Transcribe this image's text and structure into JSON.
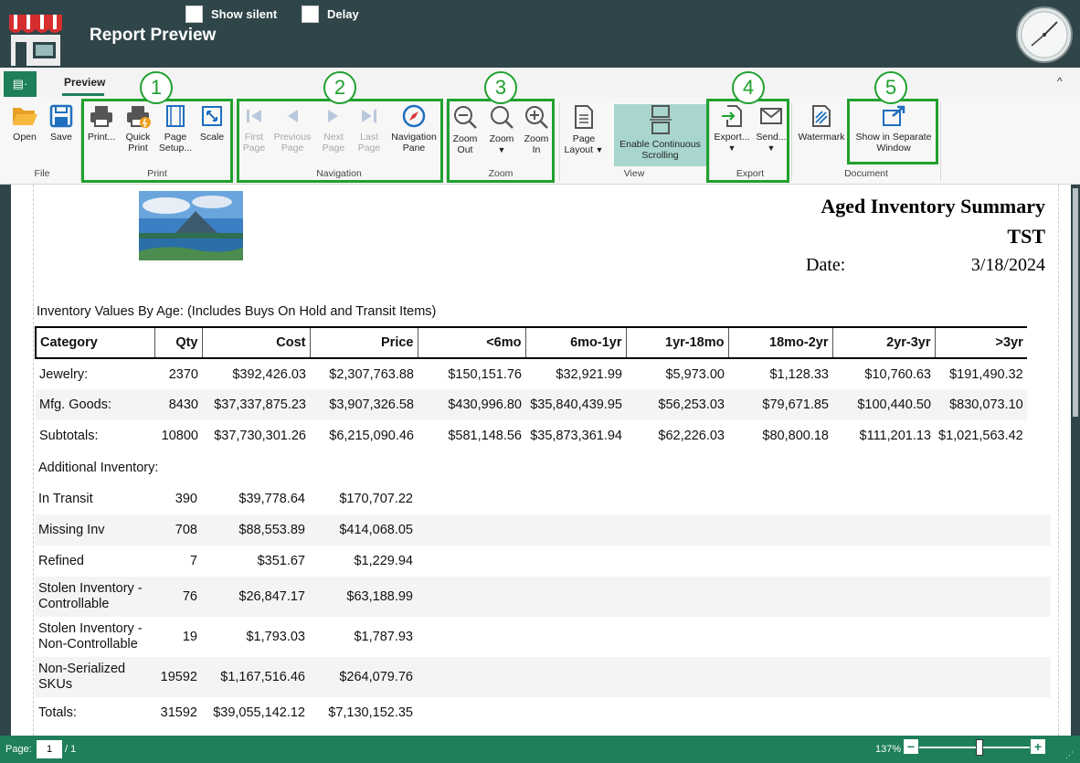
{
  "window": {
    "title": "Report Preview",
    "options": [
      {
        "label": "Show silent",
        "checked": false
      },
      {
        "label": "Delay",
        "checked": false
      }
    ]
  },
  "ribbon": {
    "file_button_glyph": "▤·",
    "tabs": [
      {
        "label": "Preview",
        "active": true
      }
    ],
    "collapse_glyph": "^",
    "groups": [
      {
        "label": "File",
        "buttons": [
          {
            "label": "Open",
            "icon": "folder-open-icon"
          },
          {
            "label": "Save",
            "icon": "save-icon"
          }
        ]
      },
      {
        "label": "Print",
        "buttons": [
          {
            "label": "Print...",
            "icon": "printer-icon"
          },
          {
            "label": "Quick Print",
            "icon": "quick-print-icon"
          },
          {
            "label": "Page Setup...",
            "icon": "page-setup-icon"
          },
          {
            "label": "Scale",
            "icon": "scale-icon"
          }
        ]
      },
      {
        "label": "Navigation",
        "buttons": [
          {
            "label": "First Page",
            "icon": "first-page-icon",
            "enabled": false
          },
          {
            "label": "Previous Page",
            "icon": "previous-page-icon",
            "enabled": false
          },
          {
            "label": "Next Page",
            "icon": "next-page-icon",
            "enabled": false
          },
          {
            "label": "Last Page",
            "icon": "last-page-icon",
            "enabled": false
          },
          {
            "label": "Navigation Pane",
            "icon": "compass-icon",
            "enabled": true
          }
        ]
      },
      {
        "label": "Zoom",
        "buttons": [
          {
            "label": "Zoom Out",
            "icon": "zoom-out-icon"
          },
          {
            "label": "Zoom",
            "icon": "zoom-icon"
          },
          {
            "label": "Zoom In",
            "icon": "zoom-in-icon"
          }
        ]
      },
      {
        "label": "View",
        "buttons": [
          {
            "label": "Page Layout",
            "icon": "page-layout-icon"
          },
          {
            "label": "Enable Continuous Scrolling",
            "icon": "continuous-scroll-icon",
            "active": true
          }
        ]
      },
      {
        "label": "Export",
        "buttons": [
          {
            "label": "Export...",
            "icon": "export-icon"
          },
          {
            "label": "Send...",
            "icon": "mail-icon"
          }
        ]
      },
      {
        "label": "Document",
        "buttons": [
          {
            "label": "Watermark",
            "icon": "watermark-icon"
          },
          {
            "label": "Show in Separate Window",
            "icon": "separate-window-icon"
          }
        ]
      }
    ],
    "callouts": [
      "1",
      "2",
      "3",
      "4",
      "5"
    ],
    "highlight_color": "#1fa12e"
  },
  "report": {
    "title": "Aged Inventory Summary",
    "subtitle": "TST",
    "date_label": "Date:",
    "date": "3/18/2024",
    "section_note": "Inventory Values By Age: (Includes Buys On Hold and Transit Items)",
    "columns": [
      "Category",
      "Qty",
      "Cost",
      "Price",
      "<6mo",
      "6mo-1yr",
      "1yr-18mo",
      "18mo-2yr",
      "2yr-3yr",
      ">3yr"
    ],
    "rows": [
      [
        "Jewelry:",
        "2370",
        "$392,426.03",
        "$2,307,763.88",
        "$150,151.76",
        "$32,921.99",
        "$5,973.00",
        "$1,128.33",
        "$10,760.63",
        "$191,490.32"
      ],
      [
        "Mfg. Goods:",
        "8430",
        "$37,337,875.23",
        "$3,907,326.58",
        "$430,996.80",
        "$35,840,439.95",
        "$56,253.03",
        "$79,671.85",
        "$100,440.50",
        "$830,073.10"
      ],
      [
        "Subtotals:",
        "10800",
        "$37,730,301.26",
        "$6,215,090.46",
        "$581,148.56",
        "$35,873,361.94",
        "$62,226.03",
        "$80,800.18",
        "$111,201.13",
        "$1,021,563.42"
      ]
    ],
    "additional_label": "Additional Inventory:",
    "additional_rows": [
      [
        "In Transit",
        "390",
        "$39,778.64",
        "$170,707.22"
      ],
      [
        "Missing Inv",
        "708",
        "$88,553.89",
        "$414,068.05"
      ],
      [
        "Refined",
        "7",
        "$351.67",
        "$1,229.94"
      ],
      [
        "Stolen Inventory - Controllable",
        "76",
        "$26,847.17",
        "$63,188.99"
      ],
      [
        "Stolen Inventory - Non-Controllable",
        "19",
        "$1,793.03",
        "$1,787.93"
      ],
      [
        "Non-Serialized SKUs",
        "19592",
        "$1,167,516.46",
        "$264,079.76"
      ],
      [
        "Totals:",
        "31592",
        "$39,055,142.12",
        "$7,130,152.35"
      ]
    ]
  },
  "status": {
    "page_label": "Page:",
    "current_page": "1",
    "total_pages": "/ 1",
    "zoom_level": "137%",
    "zoom_minus": "−",
    "zoom_plus": "+"
  }
}
